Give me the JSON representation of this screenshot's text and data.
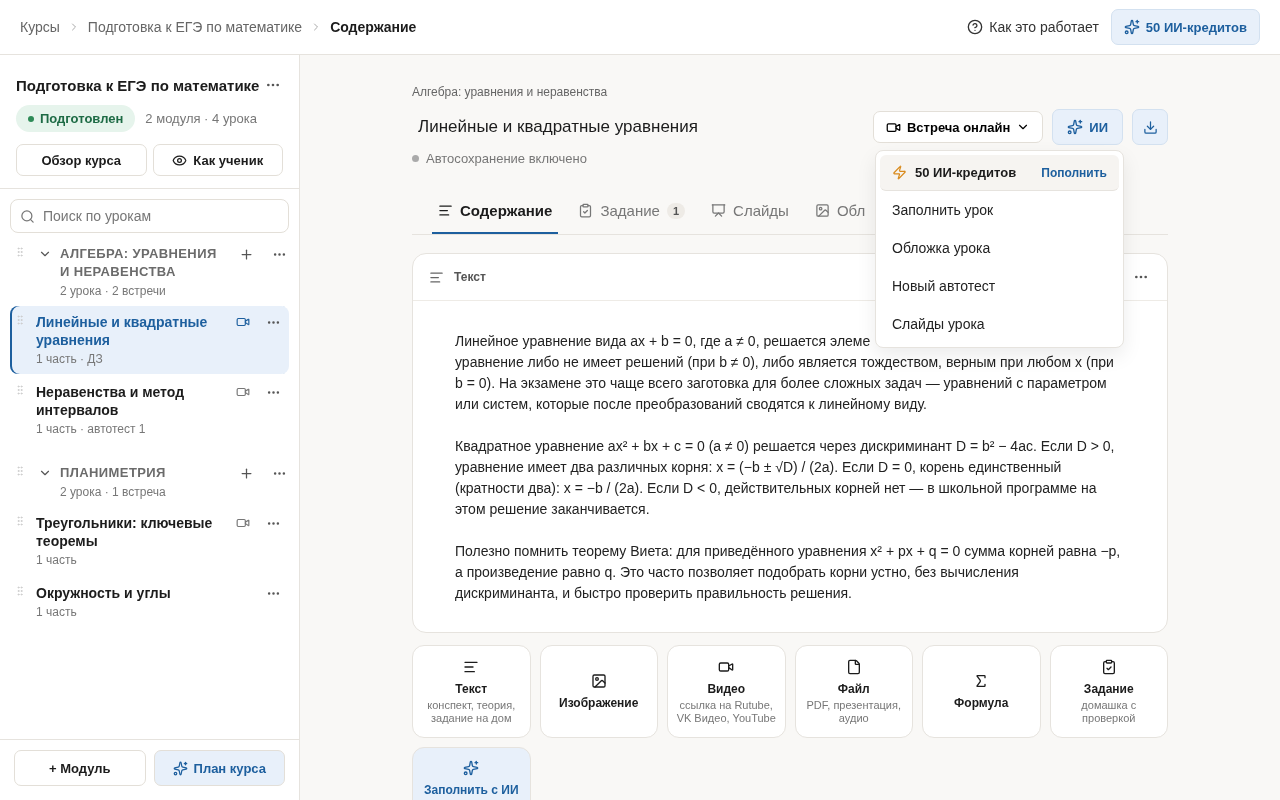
{
  "breadcrumbs": [
    {
      "label": "Курсы",
      "current": false
    },
    {
      "label": "Подготовка к ЕГЭ по математике",
      "current": false
    },
    {
      "label": "Содержание",
      "current": true
    }
  ],
  "top_actions": {
    "help": "Как это работает",
    "credits": "50 ИИ-кредитов"
  },
  "sidebar": {
    "course_title": "Подготовка к ЕГЭ по математике",
    "status": {
      "label": "Подготовлен",
      "color": "#2e8b57"
    },
    "stats": "2 модуля · 4 урока",
    "buttons": [
      {
        "label": "Обзор курса",
        "kind": "plain"
      },
      {
        "label": "Как ученик",
        "kind": "eye"
      }
    ],
    "search": {
      "placeholder": "Поиск по урокам"
    },
    "modules": [
      {
        "title": "АЛГЕБРА: УРАВНЕНИЯ И НЕРАВЕНСТВА",
        "meta": "2 урока · 2 встречи",
        "expanded": true,
        "lessons": [
          {
            "title": "Линейные и квадратные уравнения",
            "meta": "1 часть · ДЗ",
            "video": true,
            "selected": true
          },
          {
            "title": "Неравенства и метод интервалов",
            "meta": "1 часть · автотест 1",
            "video": true,
            "selected": false
          }
        ]
      },
      {
        "title": "ПЛАНИМЕТРИЯ",
        "meta": "2 урока · 1 встреча",
        "expanded": true,
        "lessons": [
          {
            "title": "Треугольники: ключевые теоремы",
            "meta": "1 часть",
            "video": true,
            "selected": false
          },
          {
            "title": "Окружность и углы",
            "meta": "1 часть",
            "video": false,
            "selected": false
          }
        ]
      }
    ],
    "footer": [
      {
        "label": "+ Модуль",
        "kind": "plain"
      },
      {
        "label": "План курса",
        "kind": "ai"
      }
    ]
  },
  "lesson": {
    "section": "Алгебра: уравнения и неравенства",
    "title": "Линейные и квадратные уравнения",
    "autosave": "Автосохранение включено",
    "meeting_button": "Встреча онлайн",
    "ai_button": "ИИ",
    "tabs": [
      {
        "label": "Содержание",
        "kind": "content",
        "selected": true
      },
      {
        "label": "Задание",
        "kind": "task",
        "badge": "1",
        "selected": false
      },
      {
        "label": "Слайды",
        "kind": "slides",
        "selected": false
      },
      {
        "label": "Обл",
        "kind": "image",
        "selected": false
      }
    ],
    "block": {
      "title": "Текст",
      "first_line": "Линейное уравнение вида ax + b = 0, где a ≠ 0, решается элеме",
      "paragraphs": [
        "уравнение либо не имеет решений (при b ≠ 0), либо является тождеством, верным при любом x (при b = 0). На экзамене это чаще всего заготовка для более сложных задач — уравнений с параметром или систем, которые после преобразований сводятся к линейному виду.",
        "Квадратное уравнение ax² + bx + c = 0 (a ≠ 0) решается через дискриминант D = b² − 4ac. Если D > 0, уравнение имеет два различных корня: x = (−b ± √D) / (2a). Если D = 0, корень единственный (кратности два): x = −b / (2a). Если D < 0, действительных корней нет — в школьной программе на этом решение заканчивается.",
        "Полезно помнить теорему Виета: для приведённого уравнения x² + px + q = 0 сумма корней равна −p, а произведение равно q. Это часто позволяет подобрать корни устно, без вычисления дискриминанта, и быстро проверить правильность решения."
      ]
    },
    "add_blocks": [
      {
        "kind": "text",
        "title": "Текст",
        "hint": "конспект, теория, задание на дом"
      },
      {
        "kind": "image",
        "title": "Изображение"
      },
      {
        "kind": "video",
        "title": "Видео",
        "hint": "ссылка на Rutube, VK Видео, YouTube"
      },
      {
        "kind": "file",
        "title": "Файл",
        "hint": "PDF, презентация, аудио"
      },
      {
        "kind": "formula",
        "title": "Формула"
      },
      {
        "kind": "task",
        "title": "Задание",
        "hint": "домашка с проверкой"
      },
      {
        "kind": "ai",
        "title": "Заполнить с ИИ"
      }
    ]
  },
  "ai_menu": {
    "credits": "50 ИИ-кредитов",
    "top_up": "Пополнить",
    "items": [
      "Заполнить урок",
      "Обложка урока",
      "Новый автотест",
      "Слайды урока"
    ]
  }
}
